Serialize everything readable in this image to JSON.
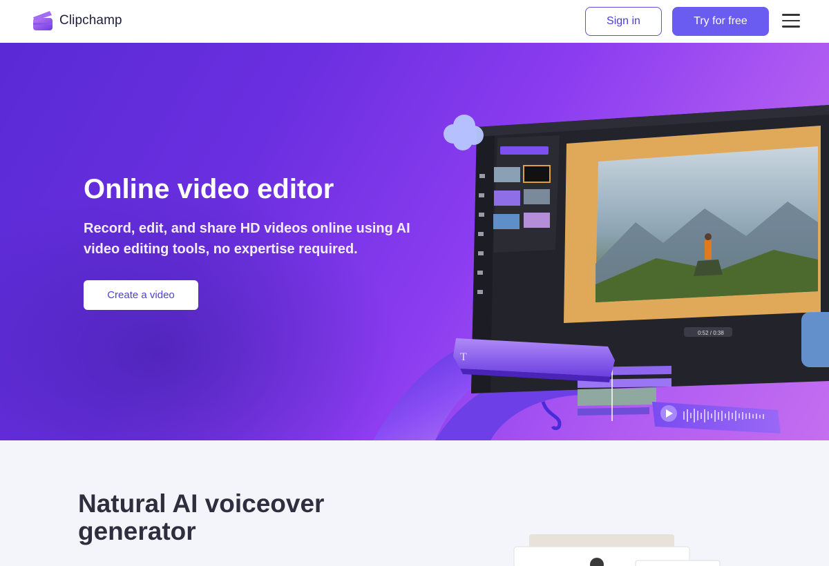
{
  "nav": {
    "brand": "Clipchamp",
    "sign_in_label": "Sign in",
    "try_label": "Try for free",
    "menu_icon": "hamburger-menu-icon"
  },
  "hero": {
    "title": "Online video editor",
    "subtitle": "Record, edit, and share HD videos online using AI video editing tools, no expertise required.",
    "cta_label": "Create a video",
    "editor_playtime": "0:52 / 0:38"
  },
  "section2": {
    "title": "Natural AI voiceover generator"
  },
  "colors": {
    "accent": "#6a5cf0",
    "hero_start": "#5a2ad6",
    "hero_end": "#c46ef0",
    "section_bg": "#f4f4fb"
  }
}
